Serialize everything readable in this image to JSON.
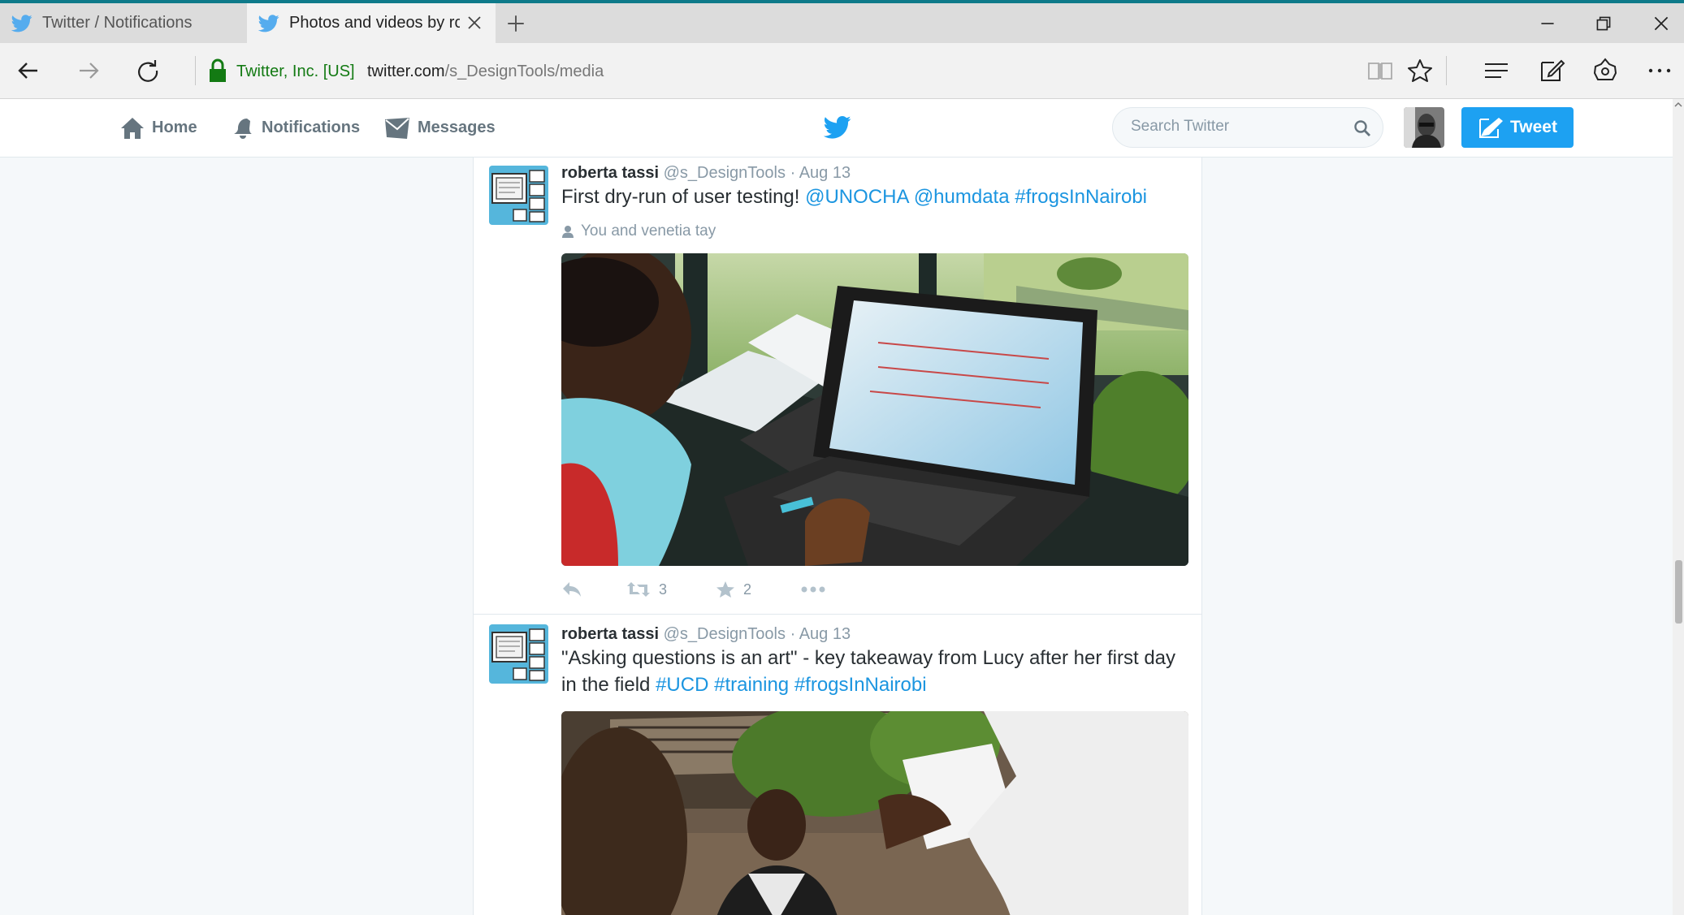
{
  "browser": {
    "tabs": [
      {
        "title": "Twitter / Notifications",
        "active": false,
        "icon": "twitter-bird-icon"
      },
      {
        "title": "Photos and videos by rc",
        "active": true,
        "icon": "twitter-bird-icon"
      }
    ],
    "address": {
      "cert_label": "Twitter, Inc. [US]",
      "url_host": "twitter.com",
      "url_path": "/s_DesignTools/media"
    },
    "accent_color": "#0e7a8a"
  },
  "twitter_nav": {
    "home_label": "Home",
    "notifications_label": "Notifications",
    "messages_label": "Messages",
    "search_placeholder": "Search Twitter",
    "tweet_button_label": "Tweet",
    "brand_color": "#1da1f2"
  },
  "tweets": [
    {
      "name": "roberta tassi",
      "handle": "@s_DesignTools",
      "dot": "·",
      "time": "Aug 13",
      "text": [
        "First dry-run of user testing! ",
        "@UNOCHA",
        " ",
        "@humdata",
        " ",
        "#frogsInNairobi"
      ],
      "context": "You and venetia tay",
      "retweets": "3",
      "likes": "2",
      "media": "photo of a person using a laptop"
    },
    {
      "name": "roberta tassi",
      "handle": "@s_DesignTools",
      "dot": "·",
      "time": "Aug 13",
      "text": [
        "\"Asking questions is an art\" - key takeaway from Lucy after her first day in the field ",
        "#UCD",
        " ",
        "#training",
        " ",
        "#frogsInNairobi"
      ],
      "media": "photo of an outdoor interview"
    }
  ]
}
